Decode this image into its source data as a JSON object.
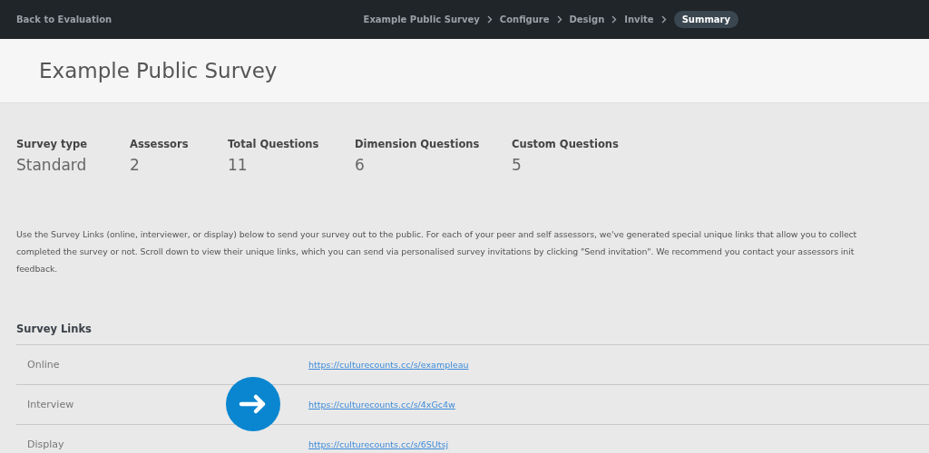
{
  "topbar": {
    "back_link": "Back to Evaluation",
    "steps": [
      {
        "label": "Example Public Survey",
        "selected": false
      },
      {
        "label": "Configure",
        "selected": false
      },
      {
        "label": "Design",
        "selected": false
      },
      {
        "label": "Invite",
        "selected": false
      },
      {
        "label": "Summary",
        "selected": true
      }
    ]
  },
  "title": "Example Public Survey",
  "stats": [
    {
      "label": "Survey type",
      "value": "Standard"
    },
    {
      "label": "Assessors",
      "value": "2"
    },
    {
      "label": "Total Questions",
      "value": "11"
    },
    {
      "label": "Dimension Questions",
      "value": "6"
    },
    {
      "label": "Custom Questions",
      "value": "5"
    }
  ],
  "intro_lines": [
    "Use the Survey Links (online, interviewer, or display) below to send your survey out to the public. For each of your peer and self assessors, we've generated special unique links that allow you to collect",
    "completed the survey or not. Scroll down to view their unique links, which you can send via personalised survey invitations by clicking \"Send invitation\". We recommend you contact your assessors init",
    "feedback."
  ],
  "survey_links": {
    "heading": "Survey Links",
    "rows": [
      {
        "name": "Online",
        "url": "https://culturecounts.cc/s/exampleau"
      },
      {
        "name": "Interview",
        "url": "https://culturecounts.cc/s/4xGc4w"
      },
      {
        "name": "Display",
        "url": "https://culturecounts.cc/s/6SUtsj"
      }
    ]
  }
}
